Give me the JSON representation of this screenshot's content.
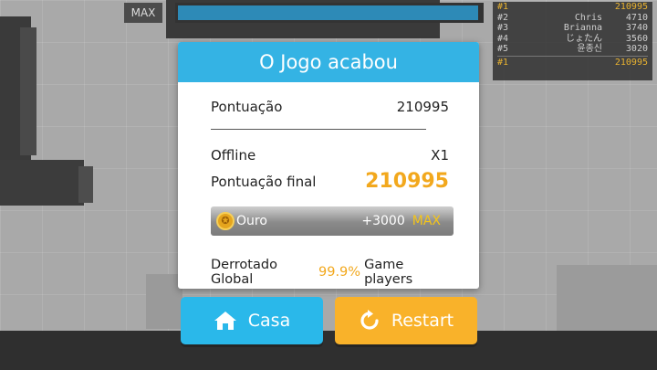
{
  "hud": {
    "max_tag": "MAX",
    "progress_fraction": 0.99
  },
  "leaderboard": {
    "rows": [
      {
        "rank": "#1",
        "name": "",
        "score": "210995",
        "highlight": true
      },
      {
        "rank": "#2",
        "name": "Chris",
        "score": "4710",
        "highlight": false
      },
      {
        "rank": "#3",
        "name": "Brianna",
        "score": "3740",
        "highlight": false
      },
      {
        "rank": "#4",
        "name": "じょたん",
        "score": "3560",
        "highlight": false
      },
      {
        "rank": "#5",
        "name": "윤종신",
        "score": "3020",
        "highlight": false
      }
    ],
    "me": {
      "rank": "#1",
      "name": "",
      "score": "210995"
    }
  },
  "dialog": {
    "title": "O Jogo acabou",
    "score_label": "Pontuação",
    "score_value": "210995",
    "offline_label": "Offline",
    "offline_value": "X1",
    "final_label": "Pontuação final",
    "final_value": "210995",
    "gold_label": "Ouro",
    "gold_amount": "+3000",
    "gold_max": "MAX",
    "global_prefix": "Derrotado Global",
    "global_percent": "99.9%",
    "global_suffix": "Game players"
  },
  "buttons": {
    "home_label": "Casa",
    "restart_label": "Restart"
  },
  "colors": {
    "header_blue": "#34b3e4",
    "accent_orange": "#f2a81d",
    "home_button": "#2ab8ea",
    "restart_button": "#f9b22a"
  },
  "icons": {
    "home": "home-icon",
    "restart": "restart-icon",
    "coin": "coin-icon"
  }
}
